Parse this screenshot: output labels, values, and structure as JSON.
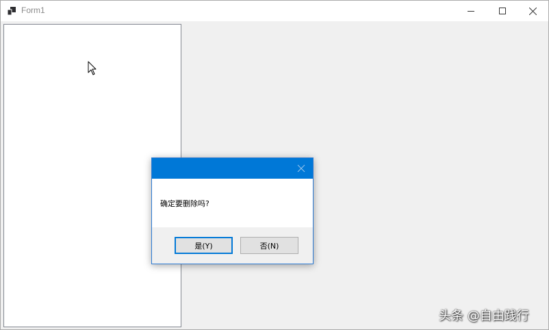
{
  "window": {
    "title": "Form1",
    "icon": "winforms-app-icon",
    "caption_buttons": [
      "minimize-icon",
      "maximize-icon",
      "close-icon"
    ]
  },
  "listbox": {
    "items": []
  },
  "dialog": {
    "title": "",
    "message": "确定要删除吗?",
    "yes_label": "是(Y)",
    "no_label": "否(N)",
    "accent_color": "#0078d7"
  },
  "watermark": {
    "text": "头条 @自由践行"
  }
}
